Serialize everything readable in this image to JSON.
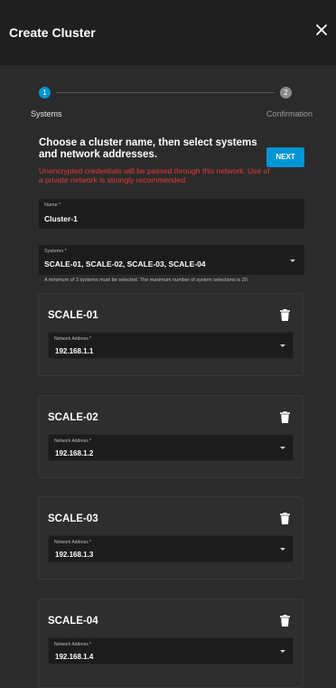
{
  "dialog": {
    "title": "Create Cluster",
    "close_icon": "close-icon"
  },
  "stepper": {
    "steps": [
      {
        "number": "1",
        "label": "Systems",
        "state": "active"
      },
      {
        "number": "2",
        "label": "Confirmation",
        "state": "inactive"
      }
    ]
  },
  "intro": {
    "heading": "Choose a cluster name, then select systems and network addresses.",
    "warning": "Unencrypted credentials will be passed through this network. Use of a private network is strongly recommended."
  },
  "next_button": "NEXT",
  "name_field": {
    "label": "Name *",
    "value": "Cluster-1"
  },
  "systems_field": {
    "label": "Systems *",
    "value": "SCALE-01, SCALE-02, SCALE-03, SCALE-04",
    "hint": "A minimum of 3 systems must be selected. The maximum number of system selections is 20."
  },
  "systems": [
    {
      "name": "SCALE-01",
      "address_label": "Network Address *",
      "address": "192.168.1.1"
    },
    {
      "name": "SCALE-02",
      "address_label": "Network Address *",
      "address": "192.168.1.2"
    },
    {
      "name": "SCALE-03",
      "address_label": "Network Address *",
      "address": "192.168.1.3"
    },
    {
      "name": "SCALE-04",
      "address_label": "Network Address *",
      "address": "192.168.1.4"
    }
  ],
  "colors": {
    "accent": "#0095d5",
    "warning": "#e53935",
    "background": "#2b2b2b",
    "header": "#1f1f1f"
  },
  "icons": {
    "delete": "trash-icon",
    "dropdown": "chevron-down-icon"
  }
}
